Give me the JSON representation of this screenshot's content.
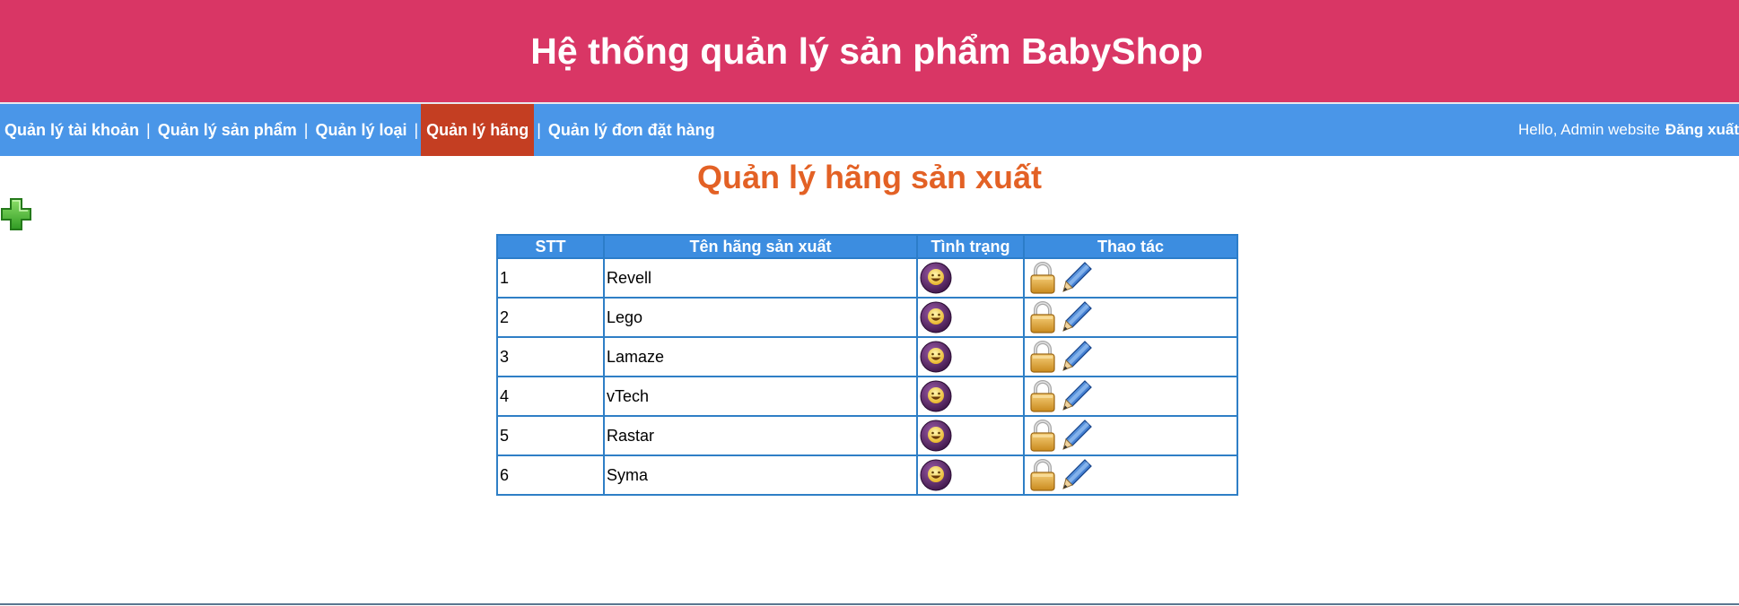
{
  "header": {
    "title": "Hệ thống quản lý sản phẩm BabyShop"
  },
  "nav": {
    "items": [
      {
        "label": "Quản lý tài khoản",
        "active": false
      },
      {
        "label": "Quản lý sản phẩm",
        "active": false
      },
      {
        "label": "Quản lý loại",
        "active": false
      },
      {
        "label": "Quản lý hãng",
        "active": true
      },
      {
        "label": "Quản lý đơn đặt hàng",
        "active": false
      }
    ],
    "separator": "|",
    "greeting": "Hello, Admin website",
    "logout_label": "Đăng xuất"
  },
  "page": {
    "title": "Quản lý hãng sản xuất"
  },
  "table": {
    "columns": [
      "STT",
      "Tên hãng sản xuất",
      "Tình trạng",
      "Thao tác"
    ],
    "rows": [
      {
        "stt": "1",
        "name": "Revell"
      },
      {
        "stt": "2",
        "name": "Lego"
      },
      {
        "stt": "3",
        "name": "Lamaze"
      },
      {
        "stt": "4",
        "name": "vTech"
      },
      {
        "stt": "5",
        "name": "Rastar"
      },
      {
        "stt": "6",
        "name": "Syma"
      }
    ]
  },
  "icons": {
    "add": "plus-icon",
    "status": "smiley-status-icon",
    "lock": "lock-icon",
    "edit": "pencil-edit-icon"
  },
  "colors": {
    "header_bg": "#d93665",
    "nav_bg": "#4a96e8",
    "nav_active_bg": "#c43e22",
    "page_title": "#e36125",
    "table_header_bg": "#3c8de0",
    "table_border": "#2f7fc6"
  }
}
